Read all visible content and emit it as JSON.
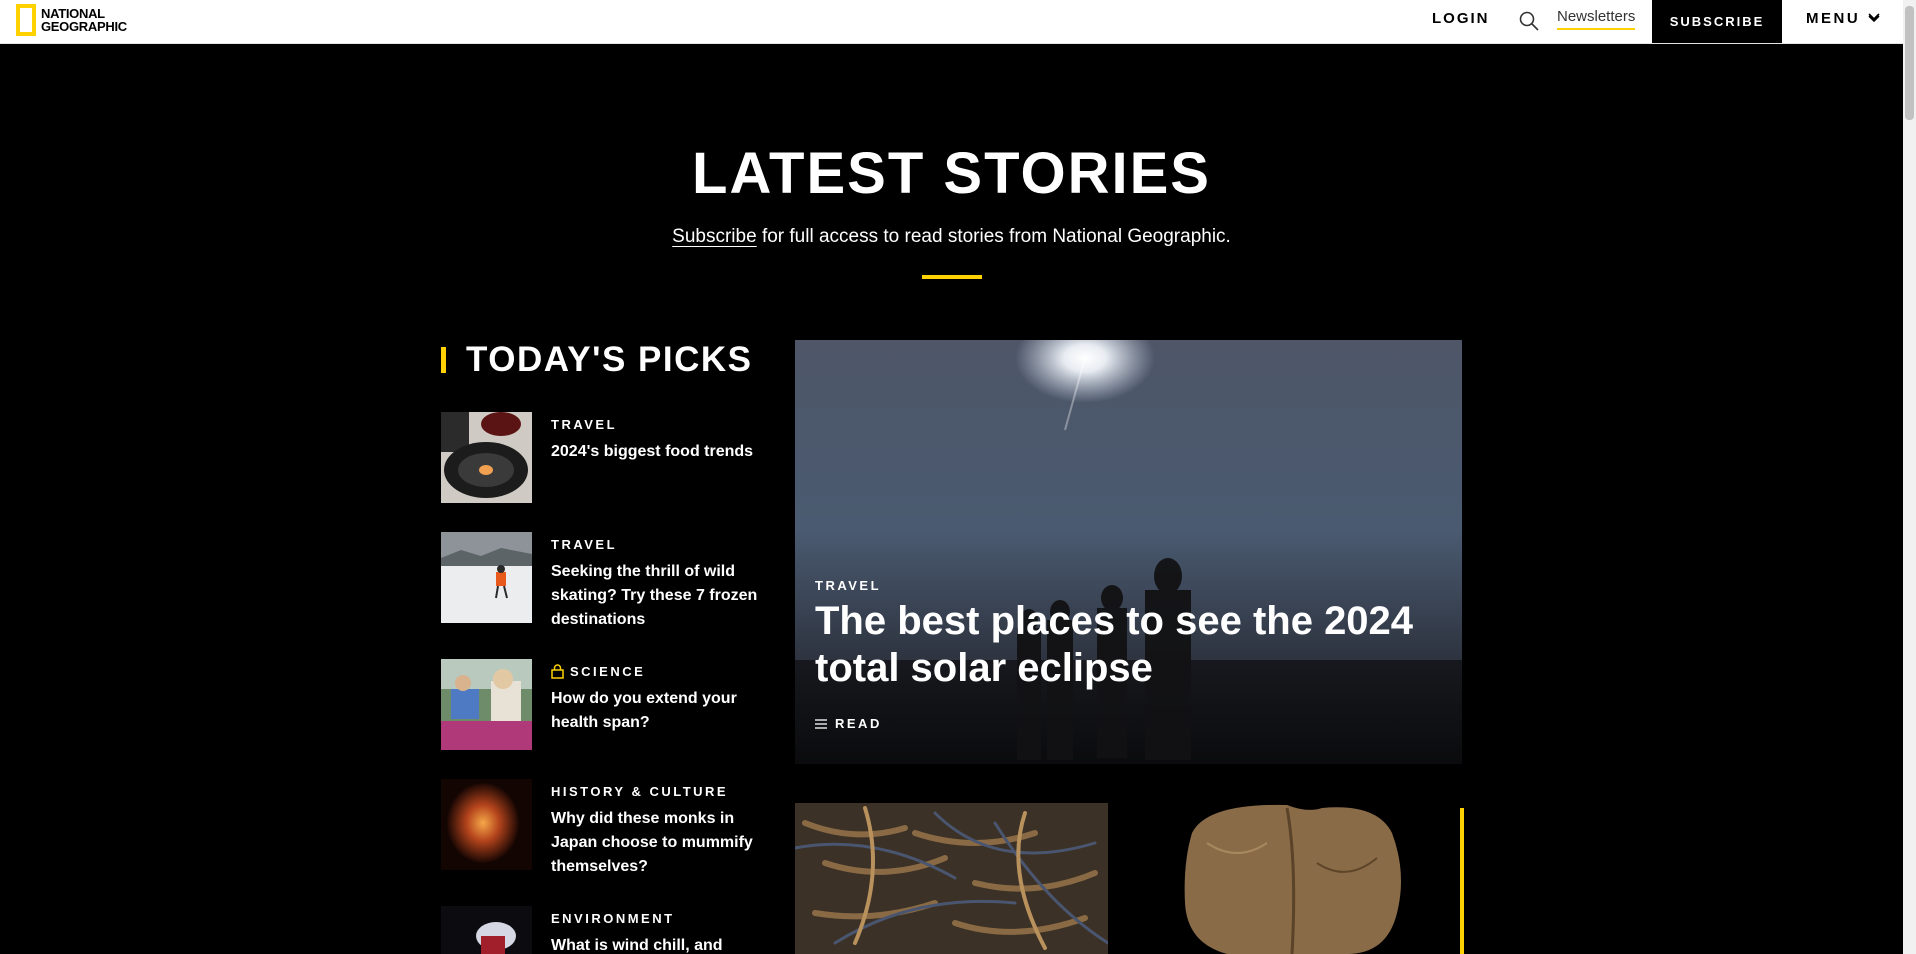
{
  "header": {
    "logo_text": "NATIONAL GEOGRAPHIC",
    "login": "LOGIN",
    "newsletters": "Newsletters",
    "subscribe": "SUBSCRIBE",
    "menu": "MENU"
  },
  "hero": {
    "title": "LATEST STORIES",
    "subscribe_link": "Subscribe",
    "subtitle_rest": " for full access to read stories from National Geographic."
  },
  "picks": {
    "heading": "TODAY'S PICKS",
    "items": [
      {
        "category": "TRAVEL",
        "title": "2024's biggest food trends",
        "locked": false
      },
      {
        "category": "TRAVEL",
        "title": "Seeking the thrill of wild skating? Try these 7 frozen destinations",
        "locked": false
      },
      {
        "category": "SCIENCE",
        "title": "How do you extend your health span?",
        "locked": true
      },
      {
        "category": "HISTORY & CULTURE",
        "title": "Why did these monks in Japan choose to mummify themselves?",
        "locked": false
      },
      {
        "category": "ENVIRONMENT",
        "title": "What is wind chill, and",
        "locked": false
      }
    ]
  },
  "feature": {
    "category": "TRAVEL",
    "title": "The best places to see the 2024 total solar eclipse",
    "read_label": "READ"
  },
  "colors": {
    "accent": "#fdd200",
    "background": "#000000",
    "header_bg": "#ffffff"
  }
}
